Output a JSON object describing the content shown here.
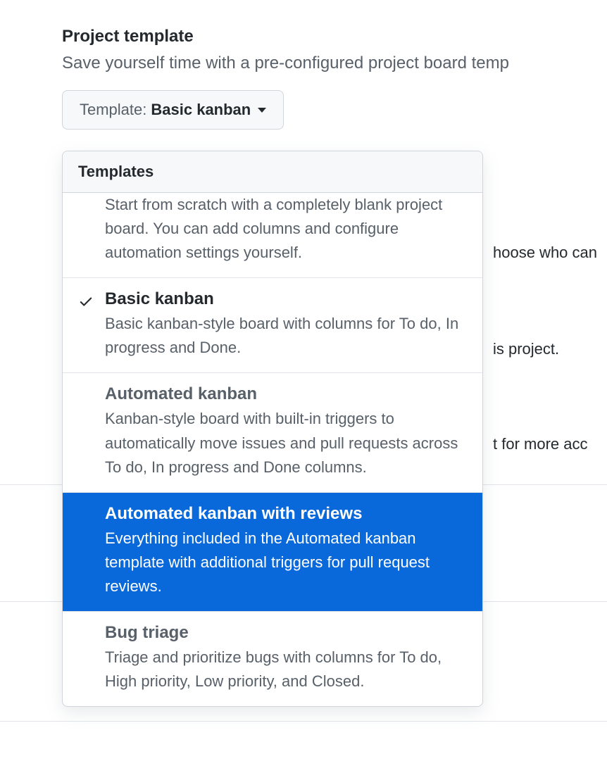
{
  "section": {
    "title": "Project template",
    "subtitle": "Save yourself time with a pre-configured project board temp"
  },
  "dropdown": {
    "prefix": "Template:",
    "value": "Basic kanban"
  },
  "menu": {
    "header": "Templates",
    "items": [
      {
        "title": "None",
        "title_visible": false,
        "desc": "Start from scratch with a completely blank project board. You can add columns and configure automation settings yourself.",
        "selected": false,
        "highlighted": false,
        "partial": true
      },
      {
        "title": "Basic kanban",
        "title_visible": true,
        "desc": "Basic kanban-style board with columns for To do, In progress and Done.",
        "selected": true,
        "highlighted": false,
        "partial": false
      },
      {
        "title": "Automated kanban",
        "title_visible": true,
        "desc": "Kanban-style triggers to automatically move issues and pull requests across To do, In progress and Done columns.",
        "desc_full": "Kanban-style board with built-in triggers to automatically move issues and pull requests across To do, In progress and Done columns.",
        "selected": false,
        "highlighted": false,
        "partial": false
      },
      {
        "title": "Automated kanban with reviews",
        "title_visible": true,
        "desc": "Everything included in the Automated kanban template with additional triggers for pull request reviews.",
        "selected": false,
        "highlighted": true,
        "partial": false
      },
      {
        "title": "Bug triage",
        "title_visible": true,
        "desc": "Triage and prioritize bugs with columns for To do, High priority, Low priority, and Closed.",
        "selected": false,
        "highlighted": false,
        "partial": false
      }
    ]
  },
  "background": {
    "t1": "hoose who can",
    "t2": "is project.",
    "t3": "t for more acc"
  }
}
